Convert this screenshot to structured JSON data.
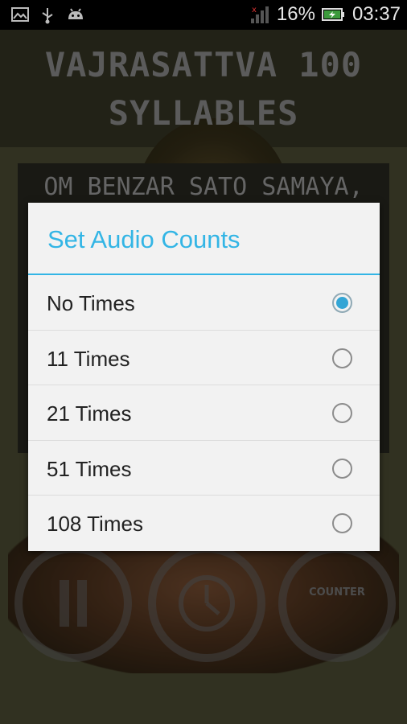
{
  "status_bar": {
    "icons": [
      "gallery-icon",
      "usb-icon",
      "android-icon",
      "signal-icon",
      "battery-icon"
    ],
    "battery_percent": "16%",
    "time": "03:37"
  },
  "app": {
    "title": "VAJRASATTVA 100 SYLLABLES",
    "mantra": "OM BENZAR SATO SAMAYA,",
    "controls": [
      {
        "name": "pause",
        "label": ""
      },
      {
        "name": "timer",
        "label": ""
      },
      {
        "name": "counter",
        "label": "COUNTER"
      }
    ]
  },
  "dialog": {
    "title": "Set Audio Counts",
    "accent_color": "#33b5e5",
    "options": [
      {
        "label": "No Times",
        "selected": true
      },
      {
        "label": "11 Times",
        "selected": false
      },
      {
        "label": "21 Times",
        "selected": false
      },
      {
        "label": "51 Times",
        "selected": false
      },
      {
        "label": "108 Times",
        "selected": false
      }
    ]
  }
}
